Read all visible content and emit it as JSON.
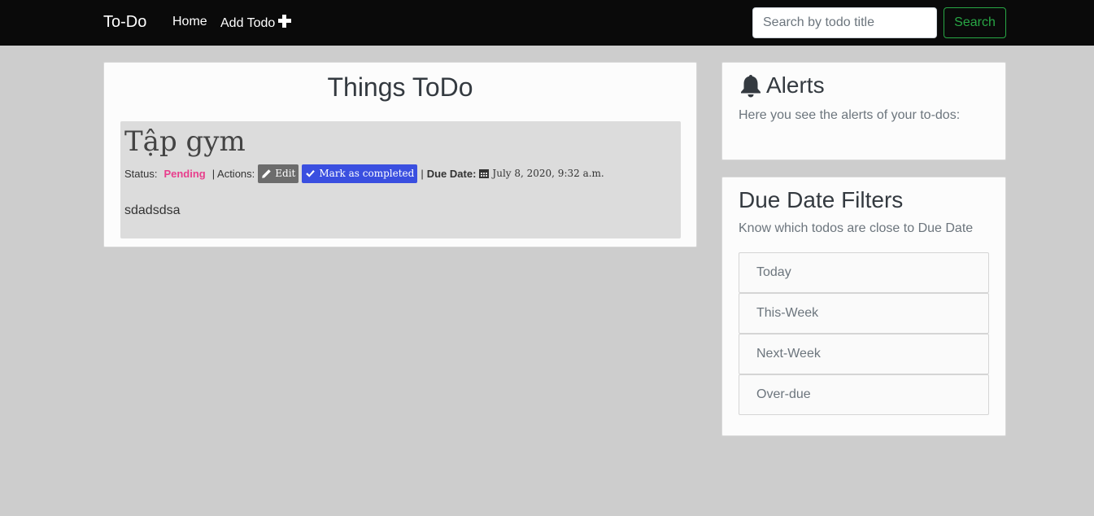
{
  "navbar": {
    "brand": "To-Do",
    "links": [
      {
        "label": "Home"
      },
      {
        "label": "Add Todo",
        "icon": "plus-icon"
      }
    ],
    "search": {
      "placeholder": "Search by todo title",
      "value": ""
    },
    "search_button": "Search"
  },
  "main": {
    "title": "Things ToDo",
    "todo": {
      "title": "Tập gym",
      "status_label": "Status:",
      "status_value": "Pending",
      "actions_label": "| Actions:",
      "edit_label": "Edit",
      "edit_icon": "pencil-icon",
      "complete_label": "Mark as completed",
      "complete_icon": "check-icon",
      "separator": "|",
      "due_label": "Due Date:",
      "due_icon": "calendar-icon",
      "due_value": "July 8, 2020, 9:32 a.m.",
      "description": "sdadsdsa"
    }
  },
  "alerts": {
    "title": "Alerts",
    "icon": "bell-icon",
    "text": "Here you see the alerts of your to-dos:"
  },
  "filters": {
    "title": "Due Date Filters",
    "text": "Know which todos are close to Due Date",
    "items": [
      {
        "label": "Today"
      },
      {
        "label": "This-Week"
      },
      {
        "label": "Next-Week"
      },
      {
        "label": "Over-due"
      }
    ]
  },
  "colors": {
    "navbar_bg": "#0a0a0a",
    "page_bg": "#cdcdcd",
    "success": "#28a745",
    "status_pending": "#e83e8c",
    "complete_button": "#3a4fe0",
    "edit_button": "#6c6c6c"
  }
}
